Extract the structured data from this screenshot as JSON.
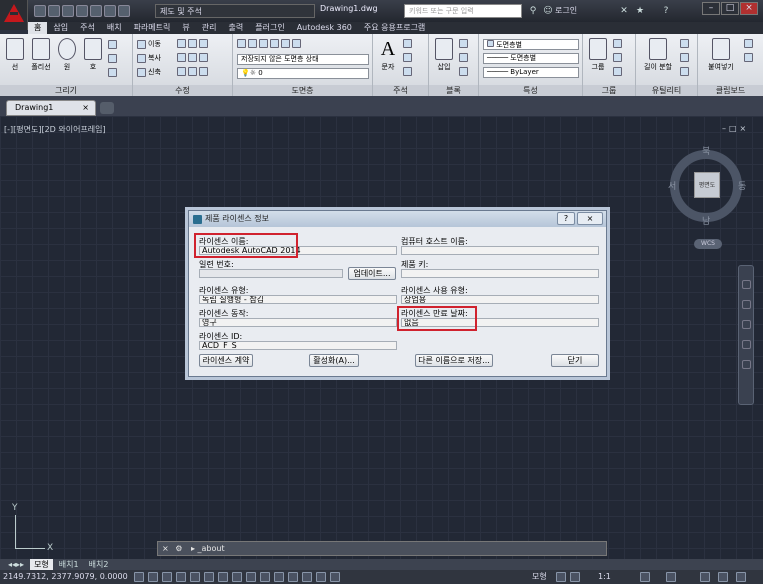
{
  "titlebar": {
    "workspace": "제도 및 주석",
    "document_title": "Drawing1.dwg",
    "search_placeholder": "키워드 또는 구문 입력",
    "login_label": "로그인"
  },
  "ribbon_tabs": [
    "홈",
    "삽입",
    "주석",
    "배치",
    "파라메트릭",
    "뷰",
    "관리",
    "출력",
    "플러그인",
    "Autodesk 360",
    "주요 응용프로그램"
  ],
  "ribbon": {
    "draw": {
      "label": "그리기",
      "tools": [
        "선",
        "폴리선",
        "원",
        "호"
      ]
    },
    "modify": {
      "label": "수정",
      "rows": [
        "이동",
        "복사",
        "신축"
      ]
    },
    "layers": {
      "label": "도면층",
      "state_combo": "저장되지 않은 도면층 상태",
      "layer_combo": "0"
    },
    "annotation": {
      "label": "주석",
      "text_tool": "문자"
    },
    "block": {
      "label": "블록",
      "insert_tool": "삽입"
    },
    "properties": {
      "label": "특성",
      "color_combo": "도면층별",
      "linetype_combo": "도면층별",
      "lineweight_combo": "ByLayer"
    },
    "groups": {
      "label": "그룹",
      "group_tool": "그룹"
    },
    "utilities": {
      "label": "유틸리티",
      "measure_tool": "길이 분할"
    },
    "clipboard": {
      "label": "클립보드",
      "paste_tool": "붙여넣기"
    }
  },
  "file_tab": {
    "label": "Drawing1"
  },
  "viewport": {
    "label": "[-][평면도][2D 와이어프레임]",
    "viewcube": {
      "face": "평면도",
      "north": "북",
      "south": "남",
      "west": "서",
      "east": "동",
      "wcs": "WCS"
    }
  },
  "ucs": {
    "x": "X",
    "y": "Y"
  },
  "command_line": {
    "text": "_about"
  },
  "layout_tabs": [
    "모형",
    "배치1",
    "배치2"
  ],
  "statusbar": {
    "coords": "2149.7312, 2377.9079, 0.0000",
    "model_label": "모형",
    "scale": "1:1"
  },
  "dialog": {
    "title": "제품 라이센스 정보",
    "help_btn": "?",
    "close_btn": "×",
    "fields": {
      "license_name": {
        "label": "라이센스 이름:",
        "value": "Autodesk AutoCAD 2014"
      },
      "computer_host": {
        "label": "컴퓨터 호스트 이름:",
        "value": ""
      },
      "serial": {
        "label": "일련 번호:",
        "value": ""
      },
      "product_key": {
        "label": "제품 키:",
        "value": ""
      },
      "license_type": {
        "label": "라이센스 유형:",
        "value": "독립 실행형 - 잠김"
      },
      "license_usage": {
        "label": "라이센스 사용 유형:",
        "value": "상업용"
      },
      "license_behavior": {
        "label": "라이센스 동작:",
        "value": "영구"
      },
      "license_expiry": {
        "label": "라이센스 만료 날짜:",
        "value": "없음"
      },
      "license_id": {
        "label": "라이센스 ID:",
        "value": "ACD_F_S"
      }
    },
    "buttons": {
      "update": "업데이트...",
      "agreement": "라이센스 계약",
      "activate": "활성화(A)...",
      "save_as": "다른 이름으로 저장...",
      "close": "닫기"
    }
  }
}
